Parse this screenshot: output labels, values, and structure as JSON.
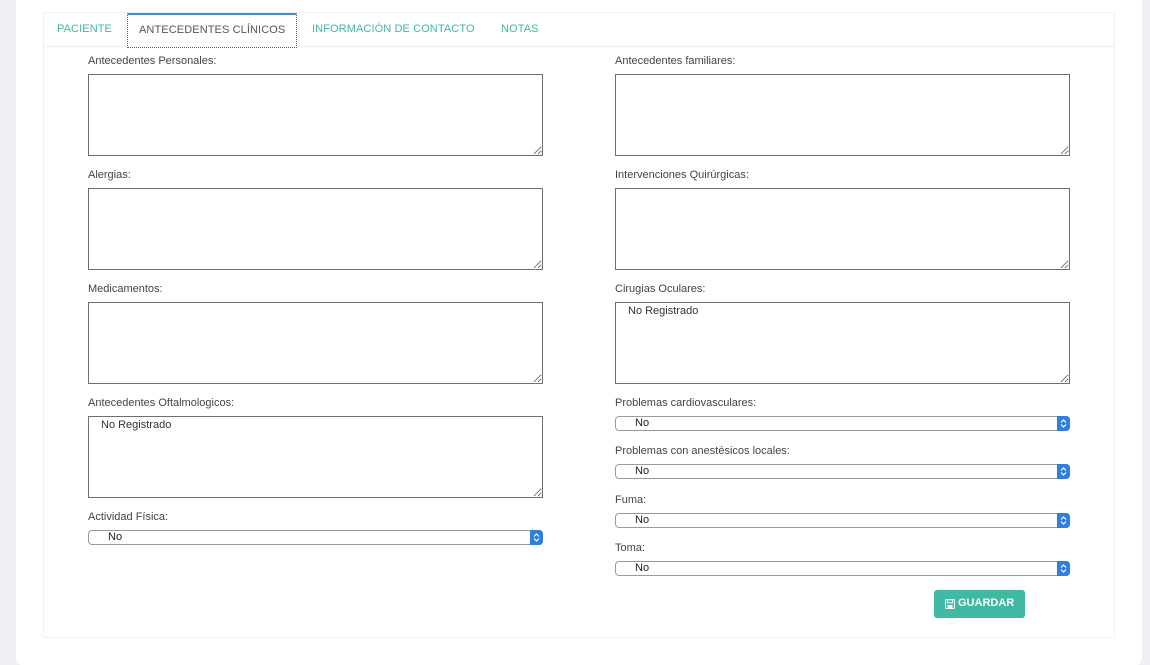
{
  "tabs": [
    {
      "label": "PACIENTE"
    },
    {
      "label": "ANTECEDENTES CLÍNICOS"
    },
    {
      "label": "INFORMACIÓN DE CONTACTO"
    },
    {
      "label": "NOTAS"
    }
  ],
  "active_tab": "ANTECEDENTES CLÍNICOS",
  "left": {
    "personales": {
      "label": "Antecedentes Personales:",
      "value": ""
    },
    "alergias": {
      "label": "Alergias:",
      "value": ""
    },
    "medicamentos": {
      "label": "Medicamentos:",
      "value": ""
    },
    "oftalmologicos": {
      "label": "Antecedentes Oftalmologicos:",
      "value": "No Registrado"
    },
    "actividad": {
      "label": "Actividad Física:",
      "value": "No"
    }
  },
  "right": {
    "familiares": {
      "label": "Antecedentes familiares:",
      "value": ""
    },
    "intervenciones": {
      "label": "Intervenciones Quirúrgicas:",
      "value": ""
    },
    "cirugias": {
      "label": "Cirugias Oculares:",
      "value": "No Registrado"
    },
    "cardio": {
      "label": "Problemas cardiovasculares:",
      "value": "No"
    },
    "anestesicos": {
      "label": "Problemas con anestésicos locales:",
      "value": "No"
    },
    "fuma": {
      "label": "Fuma:",
      "value": "No"
    },
    "toma": {
      "label": "Toma:",
      "value": "No"
    }
  },
  "save_button": {
    "label": "GUARDAR",
    "icon": "floppy-disk-icon"
  },
  "colors": {
    "accent": "#3fb9a2",
    "select_arrow": "#2f7fe0",
    "active_tab_top": "#3d8fd4"
  }
}
